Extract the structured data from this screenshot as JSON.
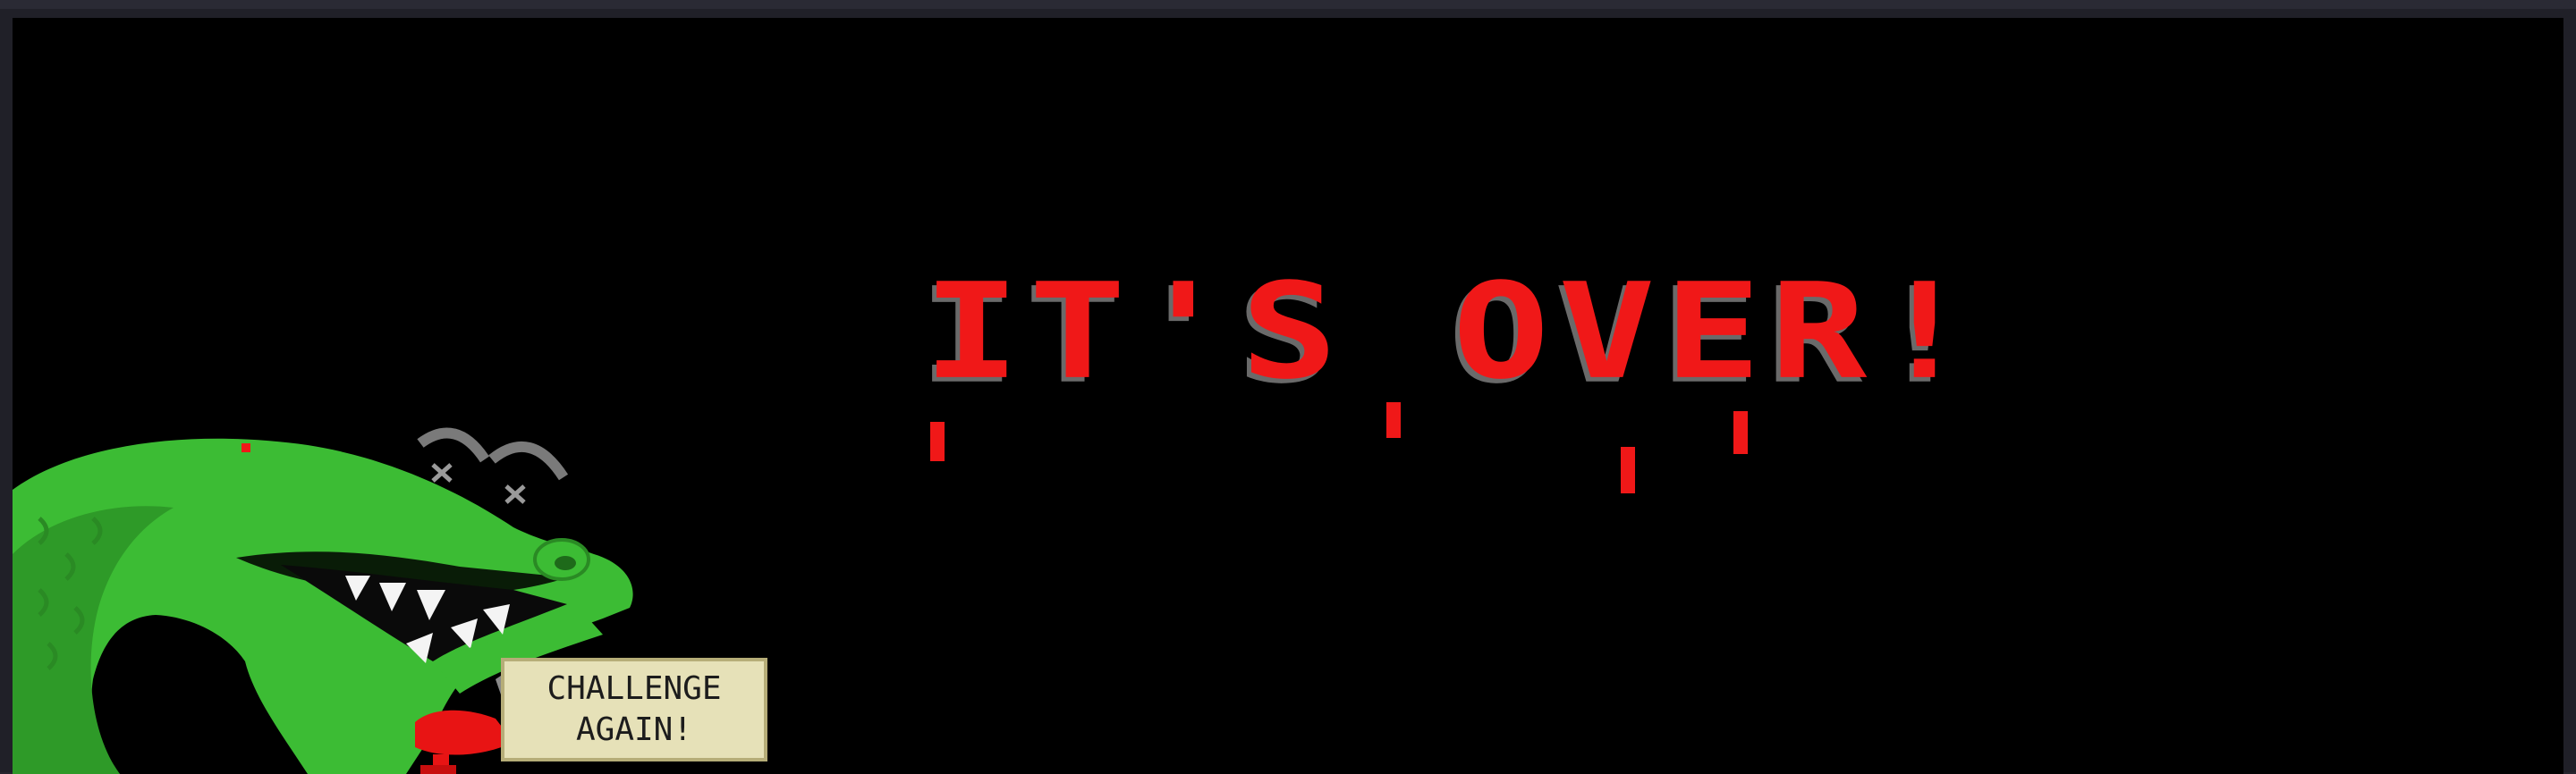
{
  "game_over": {
    "title": "IT'S OVER!",
    "button": {
      "line1": "CHALLENGE",
      "line2": "AGAIN!"
    }
  },
  "colors": {
    "background": "#000000",
    "title_red": "#f01818",
    "title_shadow": "#6a6a6a",
    "dragon_green": "#3cbc34",
    "button_bg": "#e6e1b8"
  },
  "icons": [
    "dizzy-stars-icon",
    "dragon-sprite"
  ]
}
